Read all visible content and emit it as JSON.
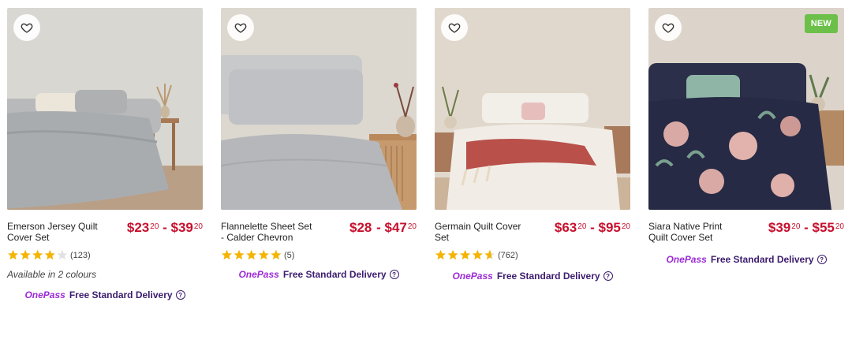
{
  "products": [
    {
      "title": "Emerson Jersey Quilt Cover Set",
      "price_from": "$23",
      "price_from_cents": "20",
      "separator": " - ",
      "price_to": "$39",
      "price_to_cents": "20",
      "rating_count": "(123)",
      "rating": 4.0,
      "note": "Available in 2 colours",
      "badge": ""
    },
    {
      "title": "Flannelette Sheet Set - Calder Chevron",
      "price_from": "$28",
      "price_from_cents": "",
      "separator": " - ",
      "price_to": "$47",
      "price_to_cents": "20",
      "rating_count": "(5)",
      "rating": 5.0,
      "note": "",
      "badge": ""
    },
    {
      "title": "Germain Quilt Cover Set",
      "price_from": "$63",
      "price_from_cents": "20",
      "separator": " - ",
      "price_to": "$95",
      "price_to_cents": "20",
      "rating_count": "(762)",
      "rating": 4.6,
      "note": "",
      "badge": ""
    },
    {
      "title": "Siara Native Print Quilt Cover Set",
      "price_from": "$39",
      "price_from_cents": "20",
      "separator": " - ",
      "price_to": "$55",
      "price_to_cents": "20",
      "rating_count": "",
      "rating": null,
      "note": "",
      "badge": "NEW"
    }
  ],
  "delivery": {
    "onepass": "OnePass",
    "label": "Free Standard Delivery",
    "help": "?"
  },
  "colors": {
    "price": "#c8102e",
    "star": "#f5b400",
    "onepass": "#9b2bd6",
    "delivery": "#3c1c6e",
    "badge": "#6cc04a"
  },
  "icons": [
    "heart-outline-icon",
    "star-icon",
    "help-circle-icon"
  ]
}
